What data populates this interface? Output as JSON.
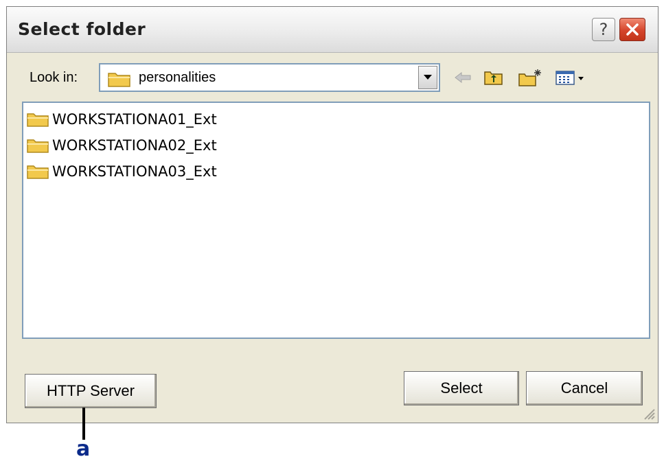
{
  "dialog": {
    "title": "Select folder",
    "help_label": "?",
    "look_in_label": "Look in:",
    "look_in_value": "personalities",
    "files": [
      {
        "name": "WORKSTATIONA01_Ext",
        "icon": "folder-icon"
      },
      {
        "name": "WORKSTATIONA02_Ext",
        "icon": "folder-icon"
      },
      {
        "name": "WORKSTATIONA03_Ext",
        "icon": "folder-icon"
      }
    ],
    "buttons": {
      "http_server": "HTTP Server",
      "select": "Select",
      "cancel": "Cancel"
    },
    "toolbar_icons": [
      "back-arrow-icon",
      "up-folder-icon",
      "new-folder-icon",
      "view-menu-icon"
    ]
  },
  "callout": {
    "label": "a"
  },
  "colors": {
    "face": "#ece9d8",
    "close": "#d5452c",
    "border": "#7f9db9",
    "callout": "#0a2a8a"
  }
}
